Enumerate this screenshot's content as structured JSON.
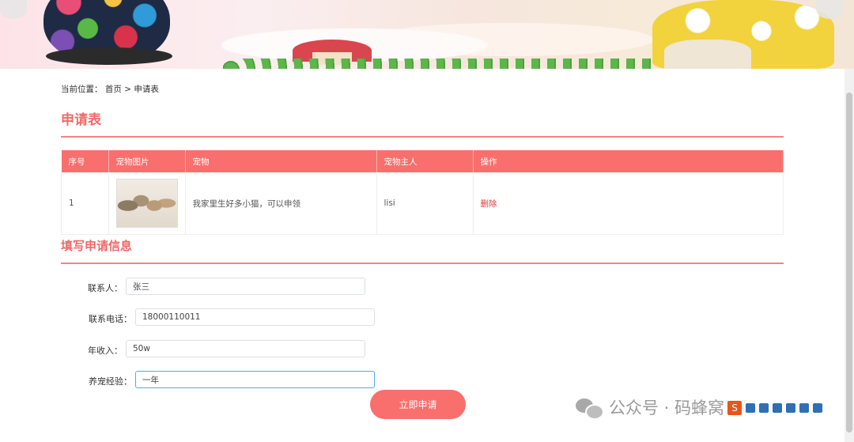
{
  "breadcrumb": {
    "prefix": "当前位置：",
    "home": "首页",
    "separator": ">",
    "current": "申请表"
  },
  "page_title": "申请表",
  "table": {
    "headers": [
      "序号",
      "宠物图片",
      "宠物",
      "宠物主人",
      "操作"
    ],
    "rows": [
      {
        "index": "1",
        "pet": "我家里生好多小猫，可以申领",
        "owner": "lisi",
        "action": "删除"
      }
    ]
  },
  "form_title": "填写申请信息",
  "form": {
    "contact_label": "联系人：",
    "contact_value": "张三",
    "phone_label": "联系电话：",
    "phone_value": "18000110011",
    "income_label": "年收入：",
    "income_value": "50w",
    "experience_label": "养宠经验：",
    "experience_value": "一年",
    "submit_label": "立即申请"
  },
  "watermark": {
    "text": "公众号 · 码蜂窝源码"
  },
  "colors": {
    "accent": "#f86f6d",
    "title": "#f06a6a",
    "delete": "#e0393e"
  }
}
